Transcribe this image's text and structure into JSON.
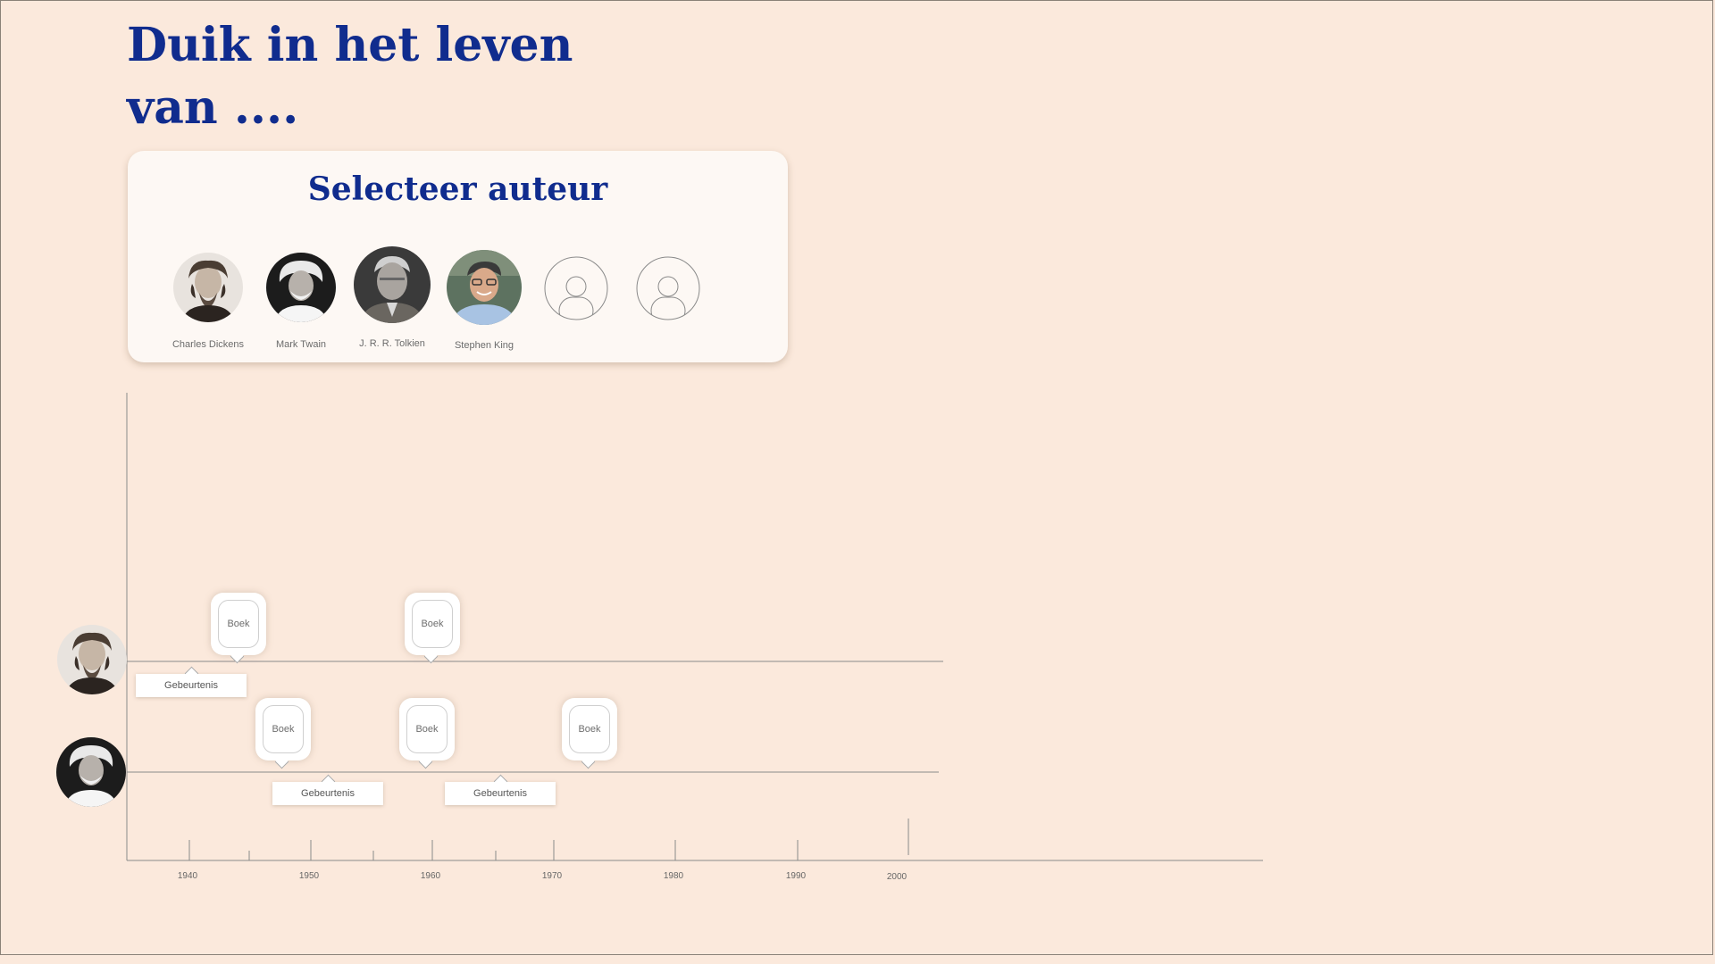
{
  "page": {
    "title_line1": "Duik in het leven",
    "title_line2": "van ...."
  },
  "selector": {
    "title": "Selecteer auteur",
    "authors": [
      {
        "name": "Charles Dickens",
        "icon": "portrait-charles-dickens"
      },
      {
        "name": "Mark Twain",
        "icon": "portrait-mark-twain"
      },
      {
        "name": "J. R. R. Tolkien",
        "icon": "portrait-jrr-tolkien"
      },
      {
        "name": "Stephen King",
        "icon": "portrait-stephen-king"
      },
      {
        "name": "",
        "icon": "user-placeholder-icon"
      },
      {
        "name": "",
        "icon": "user-placeholder-icon"
      }
    ]
  },
  "timeline": {
    "tick_labels": [
      "1940",
      "1950",
      "1960",
      "1970",
      "1980",
      "1990",
      "2000"
    ],
    "rows": [
      {
        "author": "Charles Dickens",
        "books": [
          {
            "label": "Boek",
            "year": 1944
          },
          {
            "label": "Boek",
            "year": 1960
          }
        ],
        "events": [
          {
            "label": "Gebeurtenis",
            "year": 1940
          }
        ]
      },
      {
        "author": "Mark Twain",
        "books": [
          {
            "label": "Boek",
            "year": 1948
          },
          {
            "label": "Boek",
            "year": 1960
          },
          {
            "label": "Boek",
            "year": 1973
          }
        ],
        "events": [
          {
            "label": "Gebeurtenis",
            "year": 1951
          },
          {
            "label": "Gebeurtenis",
            "year": 1965
          }
        ]
      }
    ]
  },
  "colors": {
    "background": "#fbe9dc",
    "accent": "#102c8e",
    "panel": "#fdf8f4"
  }
}
